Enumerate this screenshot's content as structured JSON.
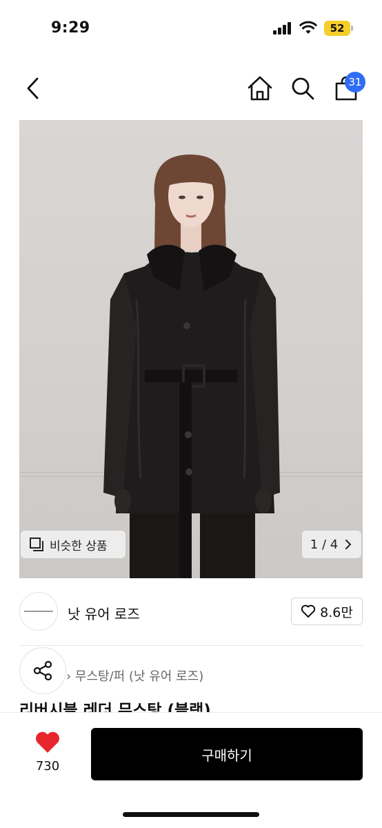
{
  "status_bar": {
    "time": "9:29",
    "battery": "52"
  },
  "nav": {
    "cart_count": "31"
  },
  "gallery": {
    "similar_label": "비슷한 상품",
    "pager": "1 / 4"
  },
  "brand": {
    "logo_text": "NOT YOUR ROSE",
    "name": "낫 유어 로즈",
    "likes": "8.6만"
  },
  "product": {
    "category": "무스탕/퍼 (낫 유어 로즈)",
    "title": "리버시블 레더 무스탕 (블랙)"
  },
  "bottom": {
    "wish_count": "730",
    "buy_label": "구매하기"
  },
  "colors": {
    "badge": "#2f6df6",
    "heart": "#e8262d",
    "battery": "#f4cf2a"
  }
}
